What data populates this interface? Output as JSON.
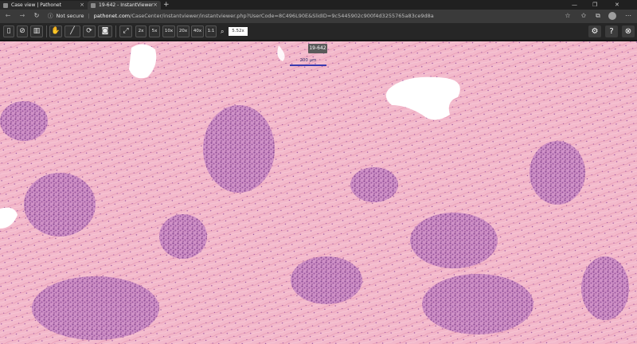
{
  "browser": {
    "tabs": [
      {
        "title": "Case view | Pathonet"
      },
      {
        "title": "19-642 - InstantViewer"
      }
    ],
    "address": {
      "security": "Not secure",
      "domain": "pathonet.com",
      "path": "/CaseCenter/instantviewer/instantviewer.php?UserCode=8C496L90E&SlidID=9c5445902c900f4d3255765a83ce9d8a"
    }
  },
  "viewer_toolbar": {
    "zoom_buttons": [
      "2x",
      "5x",
      "10x",
      "20x",
      "40x",
      "1:1"
    ],
    "current_zoom": "5.52x"
  },
  "slide": {
    "case_label": "19-642",
    "scale_bar_label": "200 µm",
    "colors": {
      "tissue": "#f1b3c8",
      "nuclei": "#8b3f95",
      "stroma": "#f7c2cc"
    }
  }
}
